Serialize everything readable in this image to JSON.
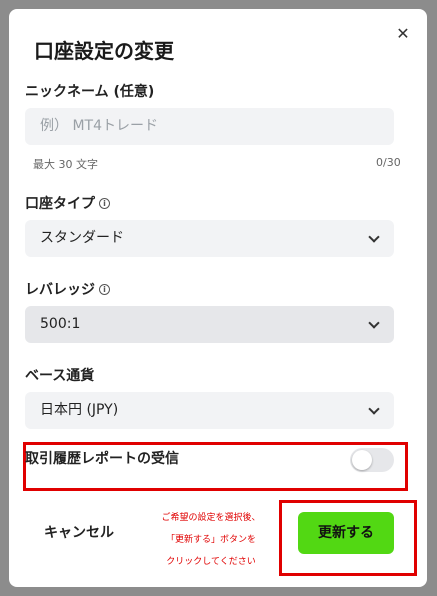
{
  "dialog": {
    "title": "口座設定の変更",
    "close_icon": "close-icon"
  },
  "nickname": {
    "label": "ニックネーム (任意)",
    "placeholder": "例） MT4トレード",
    "value": "",
    "max_hint": "最大 30 文字",
    "count": "0/30"
  },
  "account_type": {
    "label": "口座タイプ",
    "info_icon": "info-icon",
    "value": "スタンダード"
  },
  "leverage": {
    "label": "レバレッジ",
    "info_icon": "info-icon",
    "value": "500:1"
  },
  "base_currency": {
    "label": "ベース通貨",
    "value": "日本円 (JPY)"
  },
  "report": {
    "label": "取引履歴レポートの受信",
    "enabled": false
  },
  "footer": {
    "cancel_label": "キャンセル",
    "update_label": "更新する",
    "note_line1": "ご希望の設定を選択後、",
    "note_line2": "「更新する」ボタンを",
    "note_line3": "クリックしてください"
  },
  "colors": {
    "accent": "#52d813",
    "annotation_red": "#e00000"
  }
}
